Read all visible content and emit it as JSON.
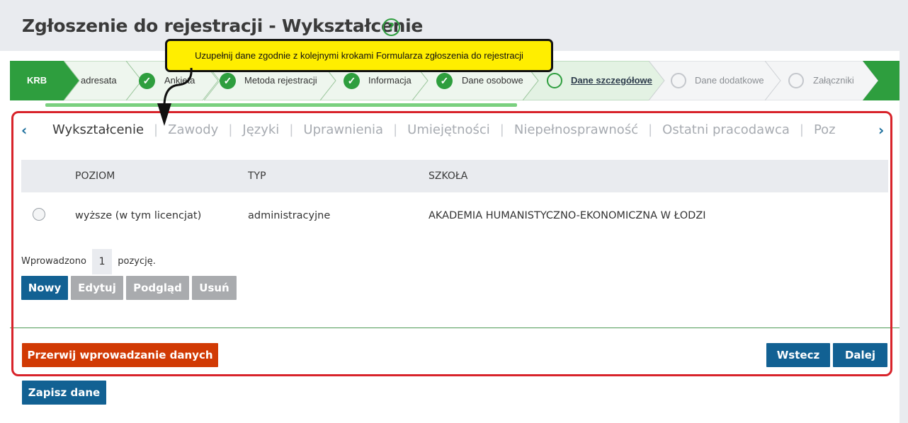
{
  "header": {
    "title": "Zgłoszenie do rejestracji - Wykształcenie",
    "help_icon": "?"
  },
  "callout": {
    "text": "Uzupełnij dane zgodnie z kolejnymi krokami Formularza zgłoszenia do rejestracji"
  },
  "stepper": {
    "start_label": "KRB",
    "steps": [
      {
        "label": "adresata",
        "state": "done"
      },
      {
        "label": "Ankieta",
        "state": "done"
      },
      {
        "label": "Metoda rejestracji",
        "state": "done"
      },
      {
        "label": "Informacja",
        "state": "done"
      },
      {
        "label": "Dane osobowe",
        "state": "done"
      },
      {
        "label": "Dane szczegółowe",
        "state": "current"
      },
      {
        "label": "Dane dodatkowe",
        "state": "pending"
      },
      {
        "label": "Załączniki",
        "state": "pending"
      }
    ],
    "check_glyph": "✓"
  },
  "tabs": {
    "prev_icon": "‹",
    "next_icon": "›",
    "items": [
      "Wykształcenie",
      "Zawody",
      "Języki",
      "Uprawnienia",
      "Umiejętności",
      "Niepełnosprawność",
      "Ostatni pracodawca",
      "Poz"
    ],
    "separator": "|"
  },
  "table": {
    "columns": [
      "POZIOM",
      "TYP",
      "SZKOŁA"
    ],
    "rows": [
      {
        "poziom": "wyższe (w tym licencjat)",
        "typ": "administracyjne",
        "szkola": "AKADEMIA HUMANISTYCZNO-EKONOMICZNA W ŁODZI"
      }
    ]
  },
  "count": {
    "prefix": "Wprowadzono",
    "value": "1",
    "suffix": "pozycję."
  },
  "actions": {
    "new": "Nowy",
    "edit": "Edytuj",
    "preview": "Podgląd",
    "delete": "Usuń"
  },
  "footer": {
    "abort": "Przerwij wprowadzanie danych",
    "back": "Wstecz",
    "next": "Dalej",
    "save": "Zapisz dane"
  },
  "colors": {
    "green": "#2e9e3e",
    "blue": "#126193",
    "red_button": "#d13a04",
    "highlight_frame": "#d8232a",
    "callout": "#ffee00"
  }
}
